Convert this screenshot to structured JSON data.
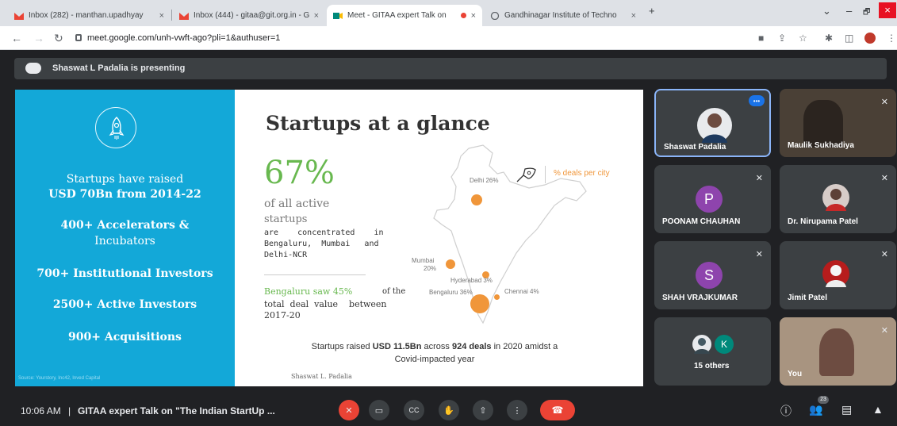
{
  "tabs": [
    {
      "title": "Inbox (282) - manthan.upadhyay",
      "close": "×"
    },
    {
      "title": "Inbox (444) - gitaa@git.org.in - G",
      "close": "×"
    },
    {
      "title": "Meet - GITAA expert Talk on",
      "close": "×"
    },
    {
      "title": "Gandhinagar Institute of Techno",
      "close": "×"
    }
  ],
  "new_tab": "+",
  "window_controls": {
    "tabs_menu": "⌄",
    "minimize": "–",
    "maximize": "🗗",
    "close": "×"
  },
  "address_bar": {
    "url": "meet.google.com/unh-vwft-ago?pli=1&authuser=1"
  },
  "presenting_banner": "Shaswat L Padalia is presenting",
  "slide": {
    "left_panel": {
      "line1": "Startups have raised",
      "line2": "USD 70Bn from 2014-22",
      "line3": "400+ Accelerators &",
      "line4": "Incubators",
      "line5": "700+ Institutional Investors",
      "line6": "2500+ Active Investors",
      "line7": "900+ Acquisitions",
      "source": "Source: Yourstory, Inc42, Inved Capital"
    },
    "title": "Startups at a glance",
    "big_percent": "67%",
    "of_all_active": "of all active",
    "startups": "startups",
    "concentrated_1": "are    concentrated    in",
    "concentrated_2": "Bengaluru,  Mumbai   and",
    "concentrated_3": "Delhi-NCR",
    "bengaluru_saw": "Bengaluru saw 45%",
    "of_the": "of the",
    "total_deal_1": "total  deal  value    between",
    "total_deal_2": "2017-20",
    "legend": "% deals per city",
    "cities": {
      "delhi": "Delhi 26%",
      "mumbai": "Mumbai",
      "mumbai_pct": "20%",
      "hyderabad": "Hyderabad  3%",
      "bengaluru": "Bengaluru  36%",
      "chennai": "Chennai  4%"
    },
    "footer_1a": "Startups raised ",
    "footer_1b": "USD 11.5Bn",
    "footer_1c": " across ",
    "footer_1d": "924 deals",
    "footer_1e": " in 2020  amidst a",
    "footer_2": "Covid-impacted year",
    "signature": "Shaswat L. Padalia"
  },
  "participants": [
    {
      "name": "Shaswat Padalia",
      "more": "•••"
    },
    {
      "name": "Maulik Sukhadiya"
    },
    {
      "name": "POONAM CHAUHAN",
      "initial": "P",
      "color": "#8e44ad"
    },
    {
      "name": "Dr. Nirupama Patel"
    },
    {
      "name": "SHAH VRAJKUMAR",
      "initial": "S",
      "color": "#8e44ad"
    },
    {
      "name": "Jimit Patel"
    },
    {
      "name": "15 others",
      "initial": "K"
    },
    {
      "name": "You"
    }
  ],
  "bottom_bar": {
    "time": "10:06 AM",
    "divider": "|",
    "meeting_title": "GITAA expert Talk on \"The Indian StartUp ...",
    "people_count": "23"
  },
  "colors": {
    "accent_blue": "#13a8d8",
    "green": "#68b84f",
    "orange": "#f0963a",
    "meet_red": "#ea4335"
  }
}
